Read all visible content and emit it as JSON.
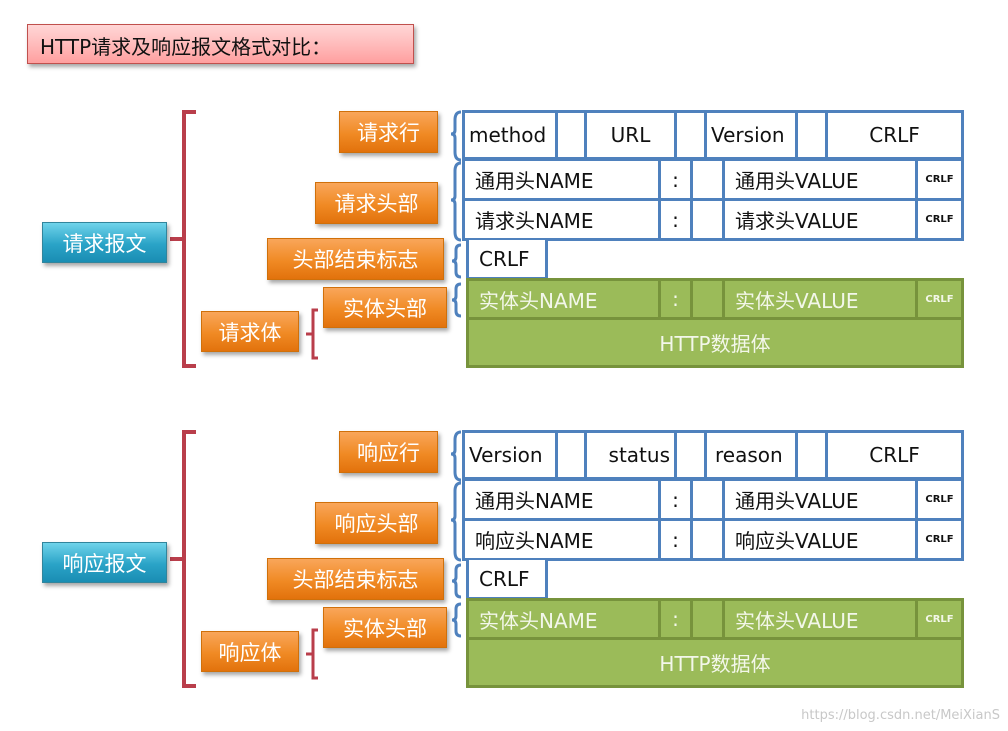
{
  "title": "HTTP请求及响应报文格式对比：",
  "colors": {
    "bracket_red": "#b93e4b",
    "brace_blue": "#4f81bd",
    "orange": "#f08a24",
    "teal": "#2aa3c7",
    "green": "#9bbb59",
    "cell_border_blue": "#4f81bd"
  },
  "request": {
    "label": "请求报文",
    "parts": {
      "line": "请求行",
      "headers": "请求头部",
      "header_end": "头部结束标志",
      "entity_header": "实体头部",
      "body": "请求体"
    },
    "line_cells": [
      "method",
      "",
      "URL",
      "",
      "Version",
      "",
      "CRLF"
    ],
    "header_rows": [
      {
        "name": "通用头NAME",
        "colon": ":",
        "value": "通用头VALUE",
        "crlf": "CRLF"
      },
      {
        "name": "请求头NAME",
        "colon": ":",
        "value": "请求头VALUE",
        "crlf": "CRLF"
      }
    ],
    "header_end": "CRLF",
    "entity_row": {
      "name": "实体头NAME",
      "colon": ":",
      "value": "实体头VALUE",
      "crlf": "CRLF"
    },
    "data_body": "HTTP数据体"
  },
  "response": {
    "label": "响应报文",
    "parts": {
      "line": "响应行",
      "headers": "响应头部",
      "header_end": "头部结束标志",
      "entity_header": "实体头部",
      "body": "响应体"
    },
    "line_cells": [
      "Version",
      "",
      "status",
      "",
      "reason",
      "",
      "CRLF"
    ],
    "header_rows": [
      {
        "name": "通用头NAME",
        "colon": ":",
        "value": "通用头VALUE",
        "crlf": "CRLF"
      },
      {
        "name": "响应头NAME",
        "colon": ":",
        "value": "响应头VALUE",
        "crlf": "CRLF"
      }
    ],
    "header_end": "CRLF",
    "entity_row": {
      "name": "实体头NAME",
      "colon": ":",
      "value": "实体头VALUE",
      "crlf": "CRLF"
    },
    "data_body": "HTTP数据体"
  },
  "watermark": "https://blog.csdn.net/MeiXianS"
}
